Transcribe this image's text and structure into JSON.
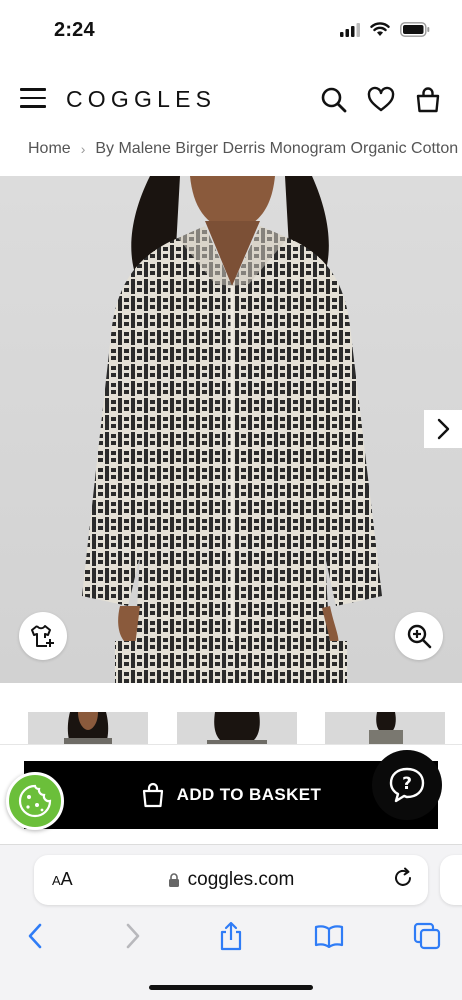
{
  "status": {
    "time": "2:24"
  },
  "header": {
    "logo": "COGGLES"
  },
  "breadcrumb": {
    "home": "Home",
    "current": "By Malene Birger Derris Monogram Organic Cotton Shirt"
  },
  "basket": {
    "label": "ADD TO BASKET"
  },
  "browser": {
    "aa_big": "A",
    "aa_small": "A",
    "url": "coggles.com"
  },
  "colors": {
    "accent": "#000000",
    "cookie": "#6bbf3a",
    "ios_blue": "#2f7cf6"
  }
}
